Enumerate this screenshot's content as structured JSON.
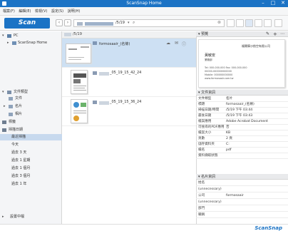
{
  "window": {
    "title": "ScanSnap Home"
  },
  "menu": {
    "items": [
      "檔案(F)",
      "編輯(E)",
      "檢視(V)",
      "設定(S)",
      "說明(H)"
    ]
  },
  "toolbar": {
    "scan_label": "Scan",
    "path_text": "/5/19"
  },
  "sidebar": {
    "tree": [
      {
        "label": "PC"
      },
      {
        "label": "ScanSnap Home"
      }
    ],
    "filter_header": "文件類型",
    "filters": [
      "文件",
      "名片",
      "相片"
    ],
    "tag_header": "標籤",
    "recent_header": "掃描日期",
    "dates": [
      "最近掃描",
      "今天",
      "過去 3 天",
      "過去 1 星期",
      "過去 1 個月",
      "過去 3 個月",
      "過去 1 年"
    ],
    "footer_label": "設置中檔"
  },
  "list": {
    "header_label": "/5/19",
    "files": [
      {
        "name": "formosaair_(名條)"
      },
      {
        "name": "_05_19_15_42_24"
      },
      {
        "name": "_05_19_15_36_24"
      }
    ]
  },
  "details": {
    "preview_header": "預覽",
    "preview_card": {
      "company": "福爾摩沙航空有限公司",
      "person": "黃敏安",
      "role": "業務部",
      "lines": [
        "Tel: 000-000-000   Fax: 000-000-000",
        "00000-000000000000",
        "Mobile: 000000000000",
        "www.formosaair.com.tw"
      ]
    },
    "properties_header": "文件資訊",
    "properties": [
      {
        "k": "文件類型",
        "v": "名片"
      },
      {
        "k": "標題",
        "v": "formosaair_(名條)"
      },
      {
        "k": "掃描日期/時間",
        "v": "/5/19 下午 03:44"
      },
      {
        "k": "最後日期",
        "v": "/5/19 下午 03:43"
      },
      {
        "k": "檔案應用",
        "v": "Adobe Acrobat Document"
      },
      {
        "k": "可搜尋的PDF應用",
        "v": "否"
      },
      {
        "k": "檔案大小",
        "v": "KB"
      },
      {
        "k": "頁數",
        "v": "2 頁"
      },
      {
        "k": "儲存資料夾",
        "v": "C:"
      },
      {
        "k": "檔名",
        "v": "pdf"
      },
      {
        "k": "資料擷取狀態",
        "v": ""
      }
    ],
    "card_header": "名片資訊",
    "card_fields": [
      {
        "k": "姓名",
        "v": ""
      },
      {
        "k": "(unnecessary)",
        "v": ""
      },
      {
        "k": "公司",
        "v": "formosaair"
      },
      {
        "k": "(unnecessary)",
        "v": ""
      },
      {
        "k": "部門",
        "v": ""
      },
      {
        "k": "職稱",
        "v": ""
      }
    ]
  },
  "status": {
    "brand": "ScanSnap"
  }
}
